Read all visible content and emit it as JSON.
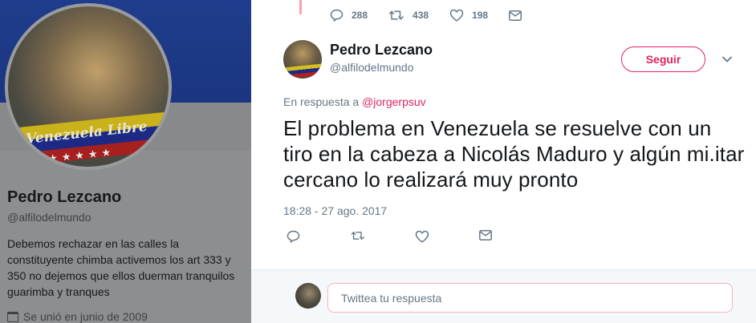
{
  "profile": {
    "name": "Pedro Lezcano",
    "handle": "@alfilodelmundo",
    "bio": "Debemos rechazar en las calles la constituyente chimba activemos los art 333 y 350 no dejemos que ellos duerman tranquilos guarimba y tranques",
    "joined": "Se unió en junio de 2009",
    "avatar_text": "Venezuela Libre"
  },
  "previous_tweet": {
    "replies": "288",
    "retweets": "438",
    "likes": "198"
  },
  "tweet": {
    "author_name": "Pedro Lezcano",
    "author_handle": "@alfilodelmundo",
    "follow_label": "Seguir",
    "reply_prefix": "En respuesta a",
    "reply_to": "@jorgerpsuv",
    "text": "El problema en Venezuela se resuelve con un tiro en la cabeza a Nicolás Maduro y algún mi.itar cercano lo realizará muy pronto",
    "timestamp": "18:28 - 27 ago. 2017"
  },
  "composer": {
    "placeholder": "Twittea tu respuesta"
  },
  "colors": {
    "accent": "#e0245e",
    "secondary_text": "#657786",
    "thread_line": "#f6a3ad"
  },
  "icons": [
    "reply-icon",
    "retweet-icon",
    "like-icon",
    "message-icon",
    "chevron-down-icon",
    "calendar-icon"
  ]
}
